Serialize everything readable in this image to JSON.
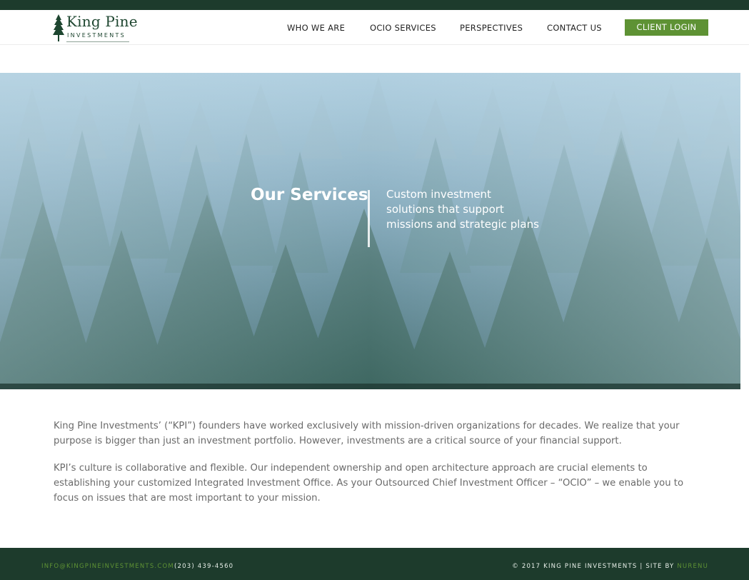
{
  "brand": {
    "name": "King Pine",
    "sub": "INVESTMENTS",
    "accent_color": "#5e9234",
    "dark_color": "#1d3b2c"
  },
  "nav": {
    "items": [
      {
        "label": "WHO WE ARE"
      },
      {
        "label": "OCIO SERVICES"
      },
      {
        "label": "PERSPECTIVES"
      },
      {
        "label": "CONTACT US"
      }
    ],
    "login_label": "CLIENT LOGIN"
  },
  "hero": {
    "title": "Our Services",
    "subtitle": "Custom investment solutions that support missions and strategic plans"
  },
  "content": {
    "paragraphs": [
      "King Pine Investments’ (“KPI”) founders have worked exclusively with mission-driven organizations for decades. We realize that your purpose is bigger than just an investment portfolio. However, investments are a critical source of your financial support.",
      "KPI’s culture is collaborative and flexible. Our independent ownership and open architecture approach are crucial elements to establishing your customized Integrated Investment Office. As your Outsourced Chief Investment Officer – “OCIO” – we enable you to focus on issues that are most important to your mission."
    ]
  },
  "footer": {
    "email": "INFO@KINGPINEINVESTMENTS.COM",
    "phone": "(203) 439-4560",
    "copyright": "© 2017 KING PINE INVESTMENTS  |  SITE BY",
    "credit": "NURENU"
  }
}
